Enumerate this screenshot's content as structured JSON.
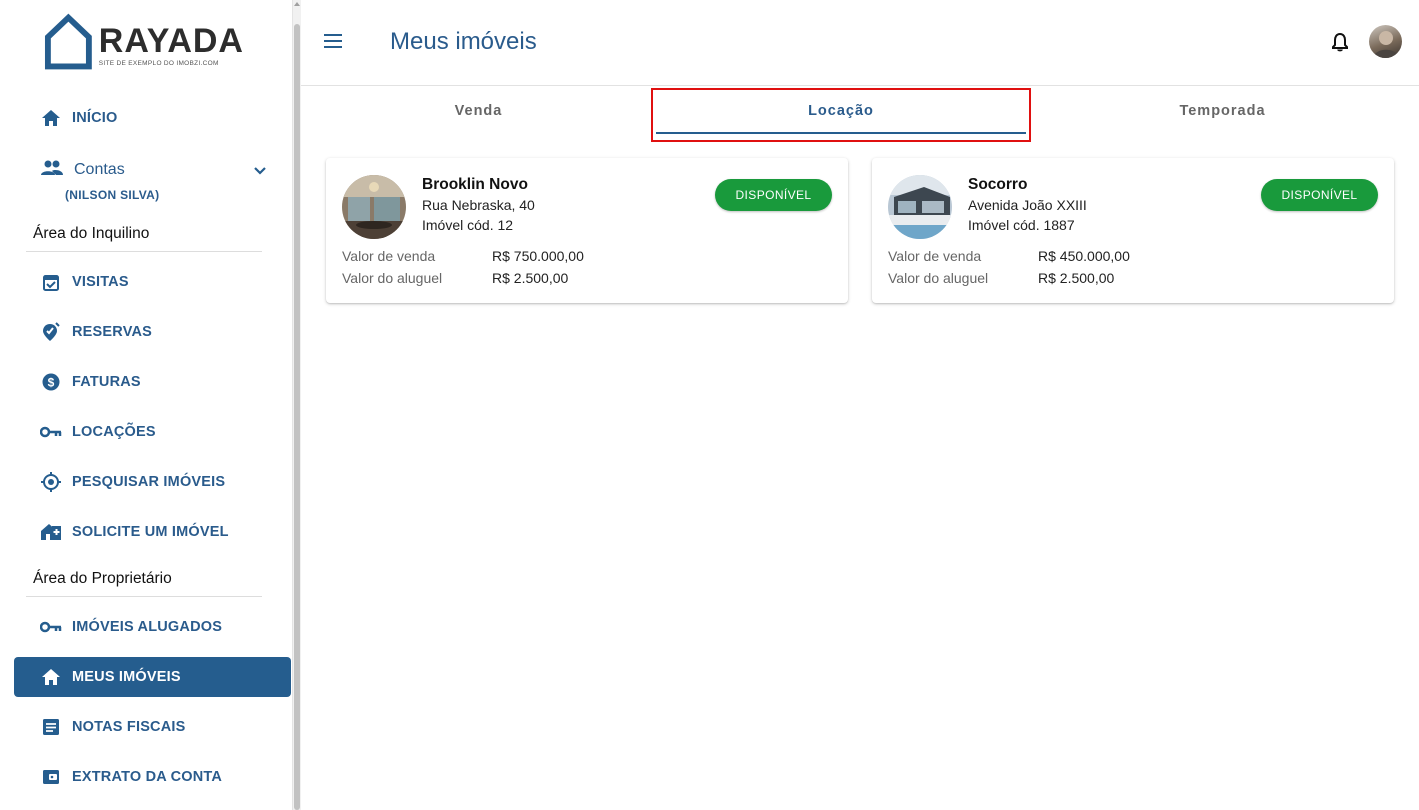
{
  "brand": {
    "name": "RAYADA",
    "tagline": "SITE DE EXEMPLO DO IMOBZI.COM",
    "color": "#255d8e"
  },
  "sidebar": {
    "inicio": {
      "label": "INÍCIO",
      "icon": "home-icon"
    },
    "contas": {
      "label": "Contas",
      "sublabel": "(NILSON SILVA)",
      "icon": "people-icon"
    },
    "section_inquilino": "Área do Inquilino",
    "inquilino_items": [
      {
        "label": "VISITAS",
        "icon": "calendar-check-icon"
      },
      {
        "label": "RESERVAS",
        "icon": "location-edit-icon"
      },
      {
        "label": "FATURAS",
        "icon": "dollar-circle-icon"
      },
      {
        "label": "LOCAÇÕES",
        "icon": "key-icon"
      },
      {
        "label": "PESQUISAR IMÓVEIS",
        "icon": "crosshair-icon"
      },
      {
        "label": "SOLICITE UM IMÓVEL",
        "icon": "add-home-icon"
      }
    ],
    "section_proprietario": "Área do Proprietário",
    "proprietario_items": [
      {
        "label": "IMÓVEIS ALUGADOS",
        "icon": "key-icon"
      },
      {
        "label": "MEUS IMÓVEIS",
        "icon": "home-icon",
        "active": true
      },
      {
        "label": "NOTAS FISCAIS",
        "icon": "document-icon"
      },
      {
        "label": "EXTRATO DA CONTA",
        "icon": "wallet-icon"
      }
    ]
  },
  "header": {
    "title": "Meus imóveis"
  },
  "tabs": [
    {
      "label": "Venda"
    },
    {
      "label": "Locação",
      "selected": true
    },
    {
      "label": "Temporada"
    }
  ],
  "properties": [
    {
      "name": "Brooklin Novo",
      "address": "Rua Nebraska, 40",
      "code": "Imóvel cód. 12",
      "status": "DISPONÍVEL",
      "sale_label": "Valor de venda",
      "sale_value": "R$ 750.000,00",
      "rent_label": "Valor do aluguel",
      "rent_value": "R$ 2.500,00"
    },
    {
      "name": "Socorro",
      "address": "Avenida João XXIII",
      "code": "Imóvel cód. 1887",
      "status": "DISPONÍVEL",
      "sale_label": "Valor de venda",
      "sale_value": "R$ 450.000,00",
      "rent_label": "Valor do aluguel",
      "rent_value": "R$ 2.500,00"
    }
  ],
  "colors": {
    "primary": "#255d8e",
    "status_green": "#199a3c",
    "highlight_red": "#e01010"
  }
}
